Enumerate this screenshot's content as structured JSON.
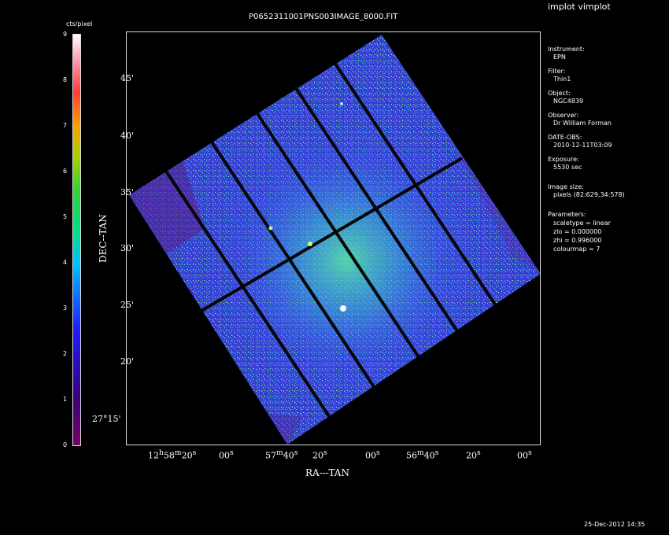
{
  "window": {
    "title": "P0652311001PNS003IMAGE_8000.FIT",
    "menu": "implot vimplot",
    "timestamp": "25-Dec-2012 14:35"
  },
  "colorbar": {
    "label": "cts/pixel",
    "ticks": [
      "0",
      "1",
      "2",
      "3",
      "4",
      "5",
      "6",
      "7",
      "8",
      "9"
    ]
  },
  "axes": {
    "x_label": "RA---TAN",
    "y_label": "DEC--TAN",
    "x_ticks": [
      {
        "main": "12",
        "sup1": "h",
        "mid": "58",
        "sup2": "m",
        "tail": "20",
        "sup3": "s"
      },
      {
        "main": "00",
        "sup1": "",
        "mid": "",
        "sup2": "",
        "tail": "",
        "sup3": "s"
      },
      {
        "main": "57",
        "sup1": "m",
        "mid": "40",
        "sup2": "s",
        "tail": "",
        "sup3": ""
      },
      {
        "main": "20",
        "sup1": "",
        "mid": "",
        "sup2": "",
        "tail": "",
        "sup3": "s"
      },
      {
        "main": "00",
        "sup1": "",
        "mid": "",
        "sup2": "",
        "tail": "",
        "sup3": "s"
      },
      {
        "main": "56",
        "sup1": "m",
        "mid": "40",
        "sup2": "s",
        "tail": "",
        "sup3": ""
      },
      {
        "main": "20",
        "sup1": "",
        "mid": "",
        "sup2": "",
        "tail": "",
        "sup3": "s"
      },
      {
        "main": "00",
        "sup1": "",
        "mid": "",
        "sup2": "",
        "tail": "",
        "sup3": "s"
      }
    ],
    "y_ticks": [
      "45'",
      "40'",
      "35'",
      "30'",
      "25'",
      "20'",
      "27°15'"
    ]
  },
  "info_panel": {
    "instrument_label": "Instrument:",
    "instrument_value": "EPN",
    "filter_label": "Filter:",
    "filter_value": "Thin1",
    "object_label": "Object:",
    "object_value": "NGC4839",
    "observer_label": "Observer:",
    "observer_value": "Dr William Forman",
    "date_label": "DATE-OBS:",
    "date_value": "2010-12-11T03:09",
    "exposure_label": "Exposure:",
    "exposure_value": "5530 sec",
    "image_size_label": "Image size:",
    "image_size_value": "pixels (82:629,34:578)",
    "parameters_label": "Parameters:",
    "parameters": [
      "scaletype = linear",
      "zlo = 0.000000",
      "zhi = 0.996000",
      "colourmap =  7"
    ]
  }
}
